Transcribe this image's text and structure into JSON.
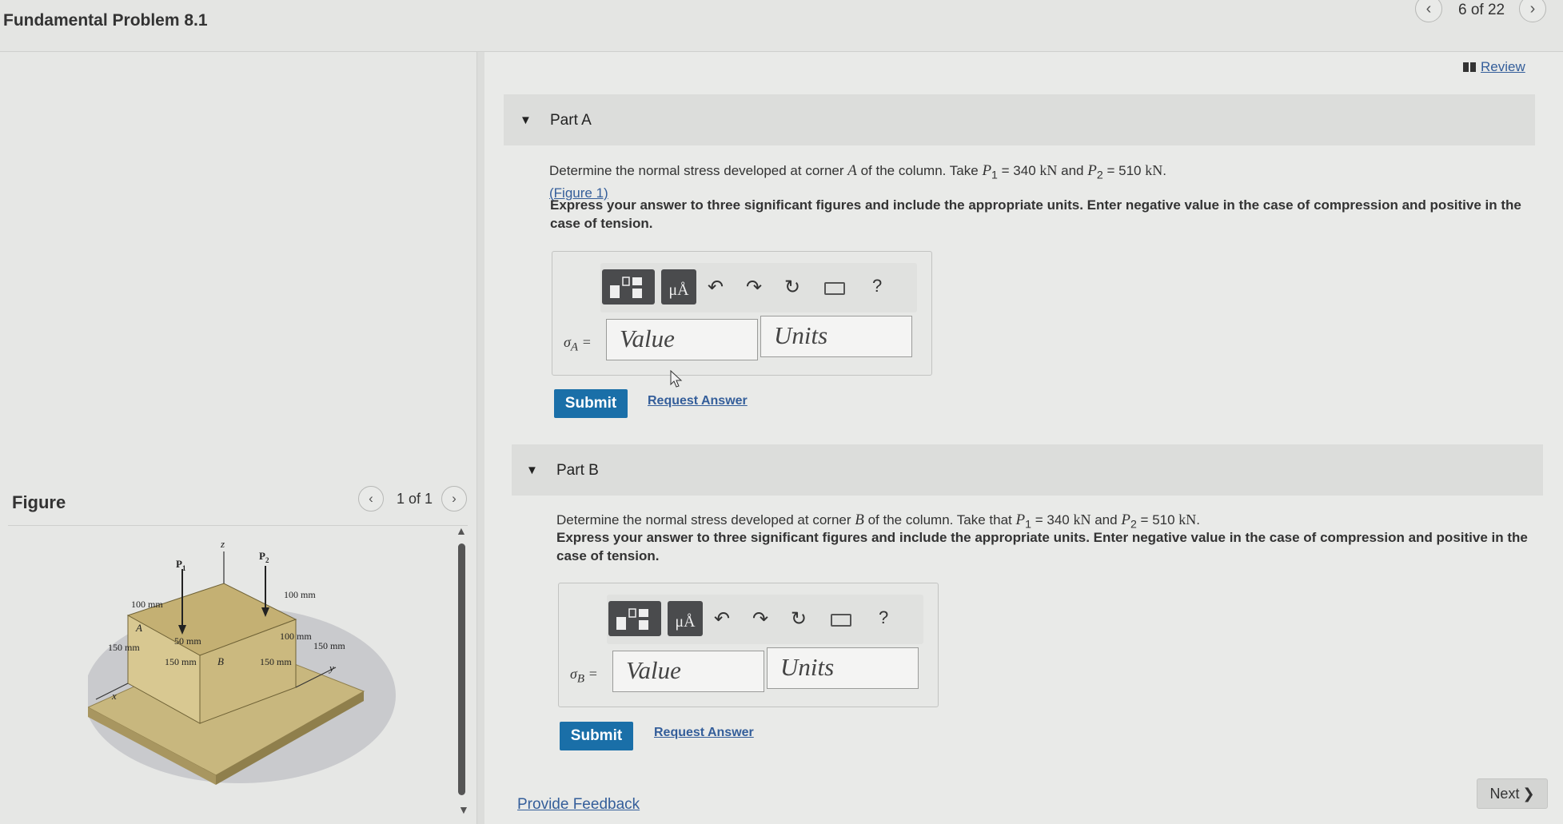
{
  "header": {
    "title": "Fundamental Problem 8.1",
    "counter": "6 of 22",
    "prev_icon": "‹",
    "next_icon": "›"
  },
  "review": {
    "label": "Review"
  },
  "figure": {
    "heading": "Figure",
    "counter": "1 of 1",
    "labels": {
      "p1": "P",
      "p1_sub": "1",
      "p2": "P",
      "p2_sub": "2",
      "z": "z",
      "x": "x",
      "y": "y",
      "a": "A",
      "b": "B",
      "d100_top_left": "100 mm",
      "d100_top_right": "100 mm",
      "d150_left": "150 mm",
      "d50": "50 mm",
      "d100_mid": "100 mm",
      "d150_right": "150 mm",
      "d150_bottom_left": "150 mm",
      "d150_bottom_right": "150 mm"
    }
  },
  "partA": {
    "title": "Part A",
    "text_pre": "Determine the normal stress developed at corner",
    "corner": "A",
    "text_mid": "of the column. Take",
    "p1_sym": "P",
    "p1_sub": "1",
    "p1_val": "= 340",
    "p1_unit": "kN",
    "and": "and",
    "p2_sym": "P",
    "p2_sub": "2",
    "p2_val": "= 510",
    "p2_unit": "kN",
    "period": ".",
    "figure_link": "(Figure 1)",
    "instructions": "Express your answer to three significant figures and include the appropriate units. Enter negative value in the case of compression and positive in the case of tension.",
    "sigma": "σ",
    "sigma_sub": "A",
    "eq": "=",
    "value_placeholder": "Value",
    "units_placeholder": "Units",
    "submit": "Submit",
    "request": "Request Answer"
  },
  "partB": {
    "title": "Part B",
    "text_pre": "Determine the normal stress developed at corner",
    "corner": "B",
    "text_mid": "of the column. Take that",
    "p1_sym": "P",
    "p1_sub": "1",
    "p1_val": "= 340",
    "p1_unit": "kN",
    "and": "and",
    "p2_sym": "P",
    "p2_sub": "2",
    "p2_val": "= 510",
    "p2_unit": "kN",
    "period": ".",
    "instructions": "Express your answer to three significant figures and include the appropriate units. Enter negative value in the case of compression and positive in the case of tension.",
    "sigma": "σ",
    "sigma_sub": "B",
    "eq": "=",
    "value_placeholder": "Value",
    "units_placeholder": "Units",
    "submit": "Submit",
    "request": "Request Answer"
  },
  "toolbar": {
    "units_label": "μÅ",
    "help_label": "?",
    "icons": [
      "templates-icon",
      "units-icon",
      "undo-icon",
      "redo-icon",
      "reset-icon",
      "keyboard-icon",
      "help-icon"
    ]
  },
  "footer": {
    "feedback": "Provide Feedback",
    "next": "Next",
    "next_chevron": "❯"
  },
  "colors": {
    "accent": "#1a6fa8",
    "link": "#345e9a",
    "background": "#e4e5e3"
  }
}
